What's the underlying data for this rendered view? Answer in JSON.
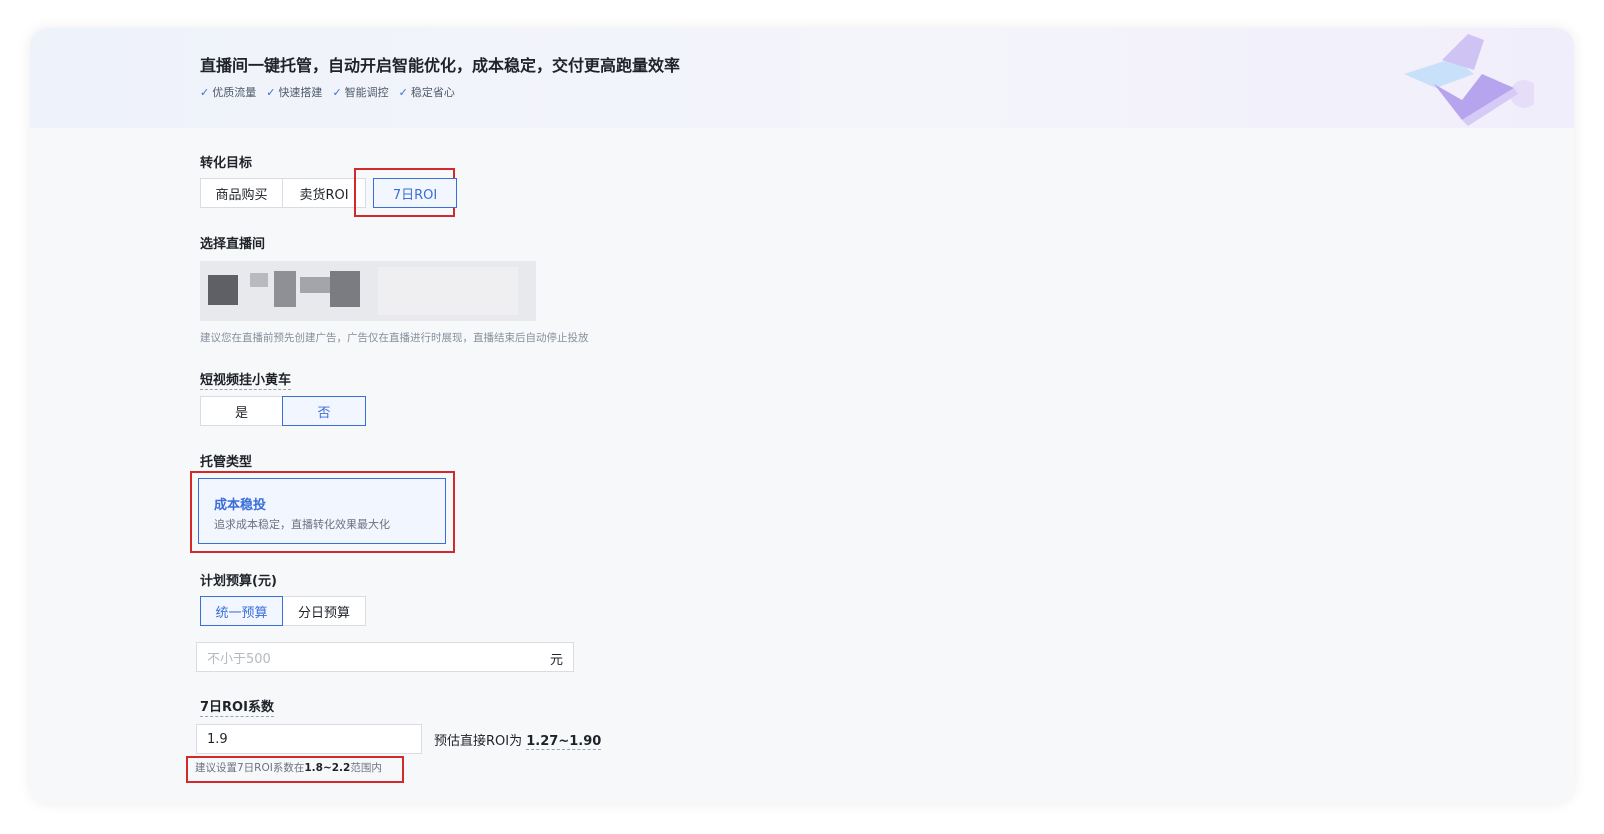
{
  "banner": {
    "title": "直播间一键托管，自动开启智能优化，成本稳定，交付更高跑量效率",
    "features": [
      "优质流量",
      "快速搭建",
      "智能调控",
      "稳定省心"
    ]
  },
  "conversion_goal": {
    "label": "转化目标",
    "options": [
      "商品购买",
      "卖货ROI",
      "7日ROI"
    ],
    "selected": "7日ROI"
  },
  "live_room": {
    "label": "选择直播间",
    "hint": "建议您在直播前预先创建广告，广告仅在直播进行时展现，直播结束后自动停止投放"
  },
  "short_video_cart": {
    "label": "短视频挂小黄车",
    "options": [
      "是",
      "否"
    ],
    "selected": "否"
  },
  "hosting_type": {
    "label": "托管类型",
    "title": "成本稳投",
    "desc": "追求成本稳定，直播转化效果最大化"
  },
  "budget": {
    "label": "计划预算(元)",
    "options": [
      "统一预算",
      "分日预算"
    ],
    "selected": "统一预算",
    "placeholder": "不小于500",
    "unit": "元"
  },
  "roi": {
    "label": "7日ROI系数",
    "value": "1.9",
    "estimate_prefix": "预估直接ROI为",
    "estimate_value": "1.27~1.90",
    "hint_prefix": "建议设置7日ROI系数在",
    "hint_range": "1.8~2.2",
    "hint_suffix": "范围内"
  },
  "colors": {
    "accent": "#3a6ed9",
    "highlight_box": "#d22a2a"
  }
}
